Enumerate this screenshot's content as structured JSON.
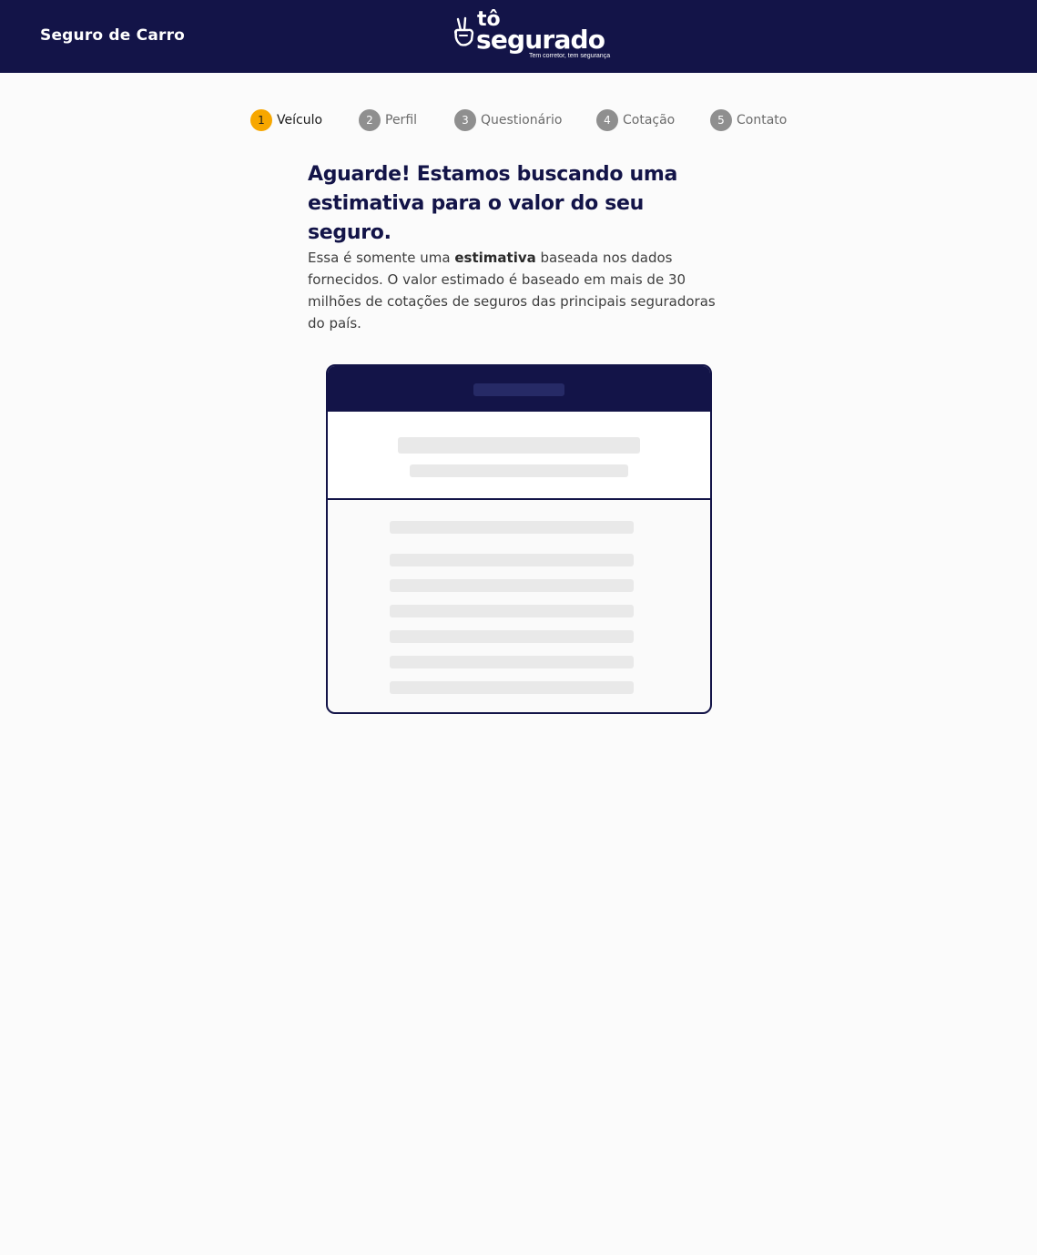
{
  "header": {
    "product_title": "Seguro de Carro",
    "logo": {
      "line1": "tô",
      "line2": "segurado",
      "tagline": "Tem corretor, tem segurança",
      "icon": "peace-hand-icon"
    },
    "background_color": "#131448"
  },
  "stepper": {
    "active_color": "#f7a700",
    "inactive_color": "#8f8f8f",
    "active_index": 0,
    "steps": [
      {
        "number": "1",
        "label": "Veículo"
      },
      {
        "number": "2",
        "label": "Perfil"
      },
      {
        "number": "3",
        "label": "Questionário"
      },
      {
        "number": "4",
        "label": "Cotação"
      },
      {
        "number": "5",
        "label": "Contato"
      }
    ]
  },
  "main": {
    "headline": "Aguarde! Estamos buscando uma estimativa para o valor do seu seguro.",
    "description": {
      "before": "Essa é somente uma ",
      "bold": "estimativa",
      "after": " baseada nos dados fornecidos. O valor estimado é baseado em mais de 30 milhões de cotações de seguros das principais seguradoras do país."
    }
  },
  "loading_card": {
    "state": "loading-skeleton"
  }
}
